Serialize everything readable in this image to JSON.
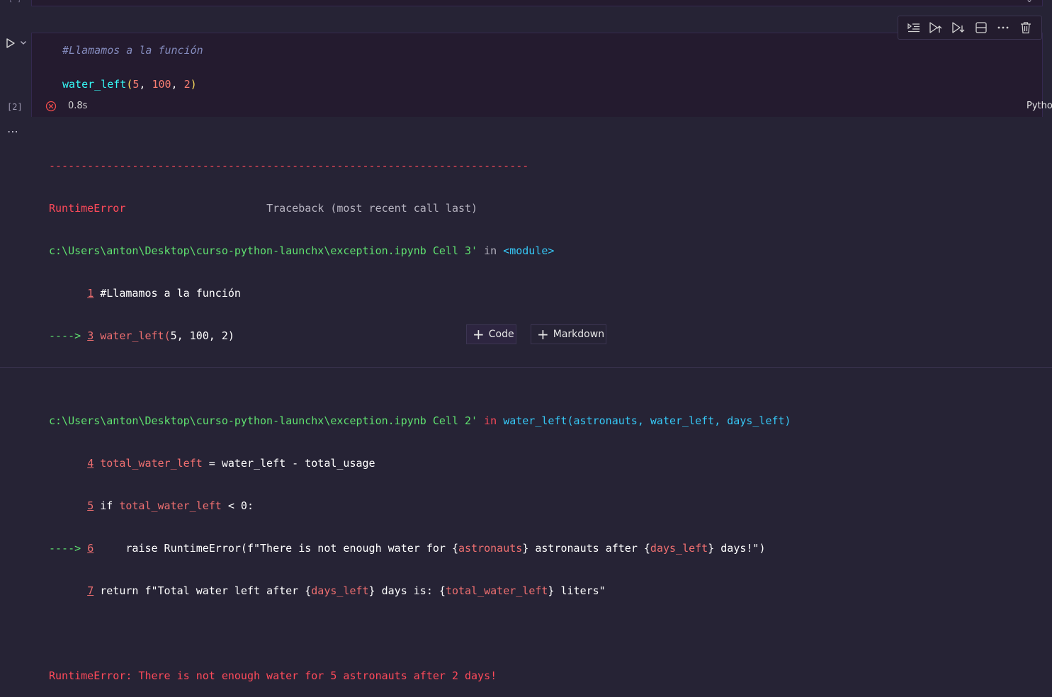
{
  "prev_cell": {
    "bracket": "[ ]"
  },
  "cell": {
    "exec_count": "[2]",
    "duration": "0.8s",
    "language": "Python",
    "code_comment": "#Llamamos a la función",
    "code_call": {
      "fn": "water_left",
      "open": "(",
      "a1": "5",
      "sep1": ", ",
      "a2": "100",
      "sep2": ", ",
      "a3": "2",
      "close": ")"
    }
  },
  "toolbar": {
    "buttons": [
      "run-by-line",
      "execute-above",
      "execute-below",
      "split-cell",
      "more-actions",
      "delete-cell"
    ]
  },
  "output": {
    "dashes": "---------------------------------------------------------------------------",
    "err_name": "RuntimeError",
    "traceback_label": "Traceback (most recent call last)",
    "frame1_path": "c:\\Users\\anton\\Desktop\\curso-python-launchx\\exception.ipynb Cell 3'",
    "in": " in ",
    "frame1_module": "<module>",
    "f1_l1_num": "1",
    "f1_l1_text": " #Llamamos a la función",
    "arrow": "----> ",
    "f1_l3_num": "3",
    "f1_l3_fn": "water_left",
    "f1_l3_open": "(",
    "f1_l3_args": "5, 100, 2",
    "f1_l3_close": ")",
    "frame2_path": "c:\\Users\\anton\\Desktop\\curso-python-launchx\\exception.ipynb Cell 2'",
    "frame2_fn": "water_left(astronauts, water_left, days_left)",
    "f2_l4_num": "4",
    "f2_l4_var": "total_water_left",
    "f2_l4_rest": " = water_left - total_usage",
    "f2_l5_num": "5",
    "f2_l5_if": " if ",
    "f2_l5_var": "total_water_left",
    "f2_l5_rest": " < 0:",
    "f2_l6_num": "6",
    "f2_l6_a": "     raise RuntimeError(f\"There is not enough water for {",
    "f2_l6_v1": "astronauts",
    "f2_l6_b": "} astronauts after {",
    "f2_l6_v2": "days_left",
    "f2_l6_c": "} days!\")",
    "f2_l7_num": "7",
    "f2_l7_a": " return f\"Total water left after {",
    "f2_l7_v1": "days_left",
    "f2_l7_b": "} days is: {",
    "f2_l7_v2": "total_water_left",
    "f2_l7_c": "} liters\"",
    "final_error": "RuntimeError: There is not enough water for 5 astronauts after 2 days!"
  },
  "add_cell": {
    "code_label": "Code",
    "markdown_label": "Markdown"
  }
}
